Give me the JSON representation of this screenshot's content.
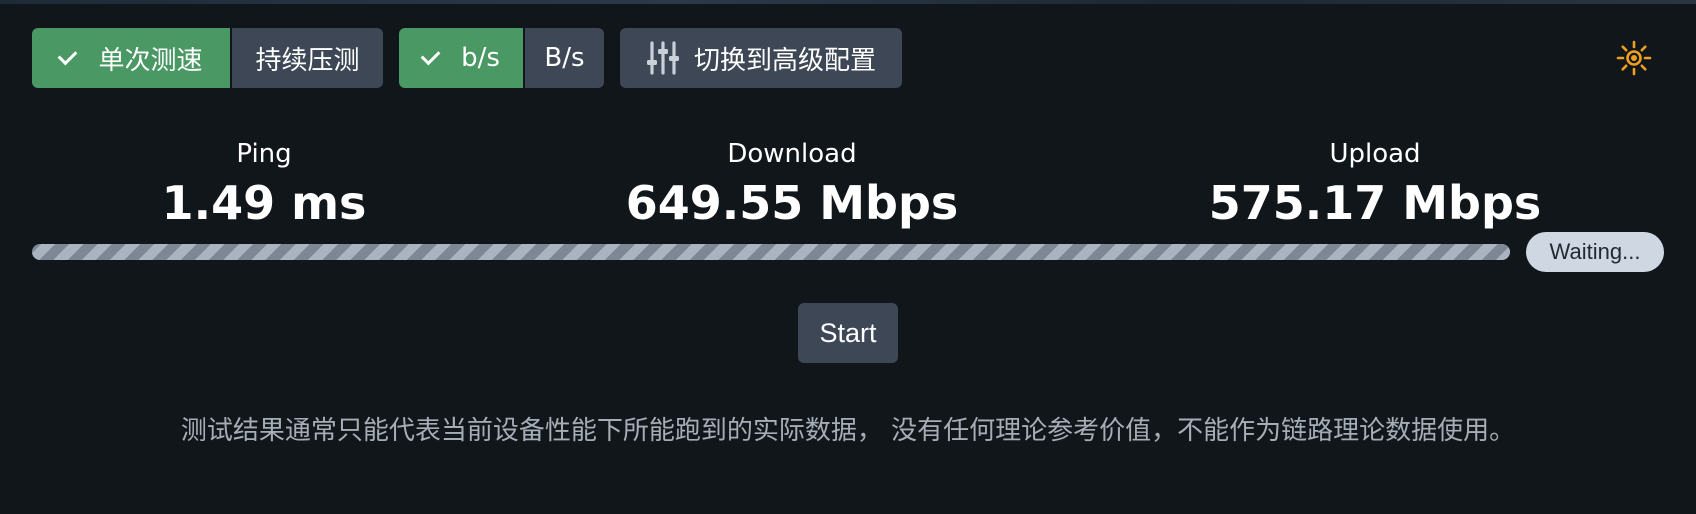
{
  "mode_toggle": {
    "options": [
      {
        "label": "单次测速",
        "active": true
      },
      {
        "label": "持续压测",
        "active": false
      }
    ]
  },
  "unit_toggle": {
    "options": [
      {
        "label": "b/s",
        "active": true
      },
      {
        "label": "B/s",
        "active": false
      }
    ]
  },
  "advanced_button": {
    "label": "切换到高级配置",
    "icon": "sliders-icon"
  },
  "theme_toggle": {
    "icon": "sun-icon",
    "color": "#f0a020"
  },
  "metrics": {
    "ping": {
      "label": "Ping",
      "value": "1.49 ms"
    },
    "download": {
      "label": "Download",
      "value": "649.55 Mbps"
    },
    "upload": {
      "label": "Upload",
      "value": "575.17 Mbps"
    }
  },
  "progress": {
    "value": 1.0,
    "status": "Waiting..."
  },
  "start_button": {
    "label": "Start"
  },
  "disclaimer": "测试结果通常只能代表当前设备性能下所能跑到的实际数据， 没有任何理论参考价值，不能作为链路理论数据使用。",
  "colors": {
    "background": "#11161b",
    "active": "#4a9863",
    "inactive": "#3d4755",
    "accent": "#f0a020"
  }
}
